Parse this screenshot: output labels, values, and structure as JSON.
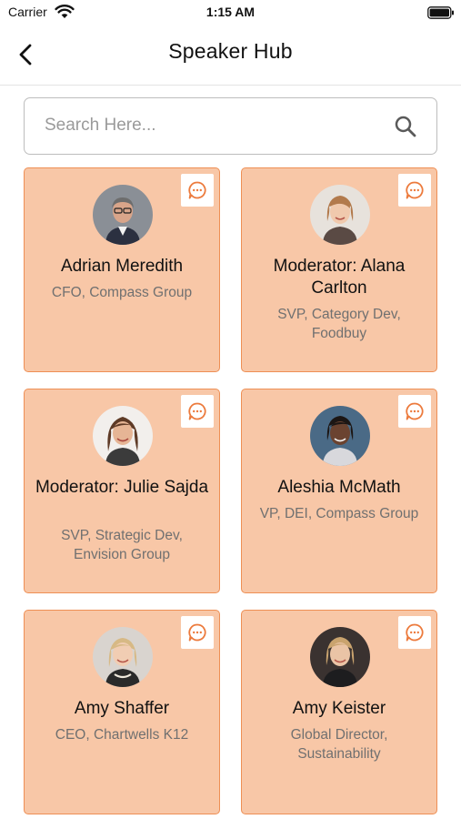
{
  "status_bar": {
    "carrier": "Carrier",
    "time": "1:15 AM"
  },
  "header": {
    "title": "Speaker Hub"
  },
  "search": {
    "placeholder": "Search Here..."
  },
  "speakers": [
    {
      "name": "Adrian Meredith",
      "title": "CFO, Compass Group"
    },
    {
      "name": "Moderator: Alana Carlton",
      "title": "SVP, Category Dev, Foodbuy"
    },
    {
      "name": "Moderator: Julie Sajda",
      "title": "SVP, Strategic Dev, Envision Group"
    },
    {
      "name": "Aleshia McMath",
      "title": "VP, DEI, Compass Group"
    },
    {
      "name": "Amy Shaffer",
      "title": "CEO, Chartwells K12"
    },
    {
      "name": "Amy Keister",
      "title": "Global Director, Sustainability"
    }
  ],
  "colors": {
    "card_bg": "#f8c7a7",
    "card_border": "#ee8f55",
    "accent": "#ec7a3c"
  },
  "icons": {
    "back": "chevron-left-icon",
    "search": "search-icon",
    "chat": "chat-bubble-icon"
  }
}
